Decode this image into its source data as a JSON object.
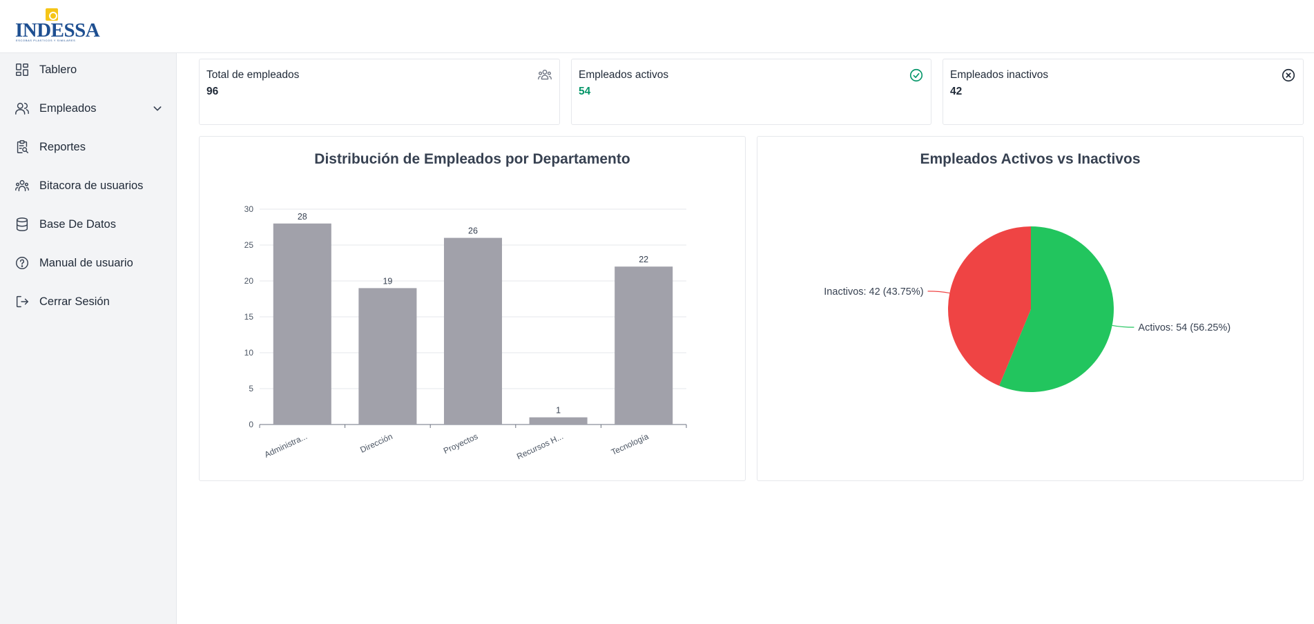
{
  "brand": {
    "name": "INDESSA",
    "tagline": "ESCOBAS PLASTICOS Y SIMILARES"
  },
  "sidebar": {
    "items": [
      {
        "label": "Tablero",
        "icon": "dashboard-icon"
      },
      {
        "label": "Empleados",
        "icon": "users-icon",
        "expandable": true
      },
      {
        "label": "Reportes",
        "icon": "clipboard-search-icon"
      },
      {
        "label": "Bitacora de usuarios",
        "icon": "user-group-icon"
      },
      {
        "label": "Base De Datos",
        "icon": "database-icon"
      },
      {
        "label": "Manual de usuario",
        "icon": "help-circle-icon"
      },
      {
        "label": "Cerrar Sesión",
        "icon": "logout-icon"
      }
    ]
  },
  "stats": [
    {
      "title": "Total de empleados",
      "value": "96",
      "icon": "people-icon"
    },
    {
      "title": "Empleados activos",
      "value": "54",
      "icon": "check-circle-icon",
      "color": "#059669"
    },
    {
      "title": "Empleados inactivos",
      "value": "42",
      "icon": "x-circle-icon"
    }
  ],
  "chart_data": [
    {
      "type": "bar",
      "title": "Distribución de Empleados por Departamento",
      "categories": [
        "Administra...",
        "Dirección",
        "Proyectos",
        "Recursos H...",
        "Tecnología"
      ],
      "values": [
        28,
        19,
        26,
        1,
        22
      ],
      "yticks": [
        0,
        5,
        10,
        15,
        20,
        25,
        30
      ],
      "ylim": [
        0,
        30
      ],
      "bar_color": "#a1a1aa",
      "grid": true
    },
    {
      "type": "pie",
      "title": "Empleados Activos vs Inactivos",
      "slices": [
        {
          "label": "Activos: 54 (56.25%)",
          "value": 54,
          "color": "#22c55e"
        },
        {
          "label": "Inactivos: 42 (43.75%)",
          "value": 42,
          "color": "#ef4444"
        }
      ]
    }
  ]
}
